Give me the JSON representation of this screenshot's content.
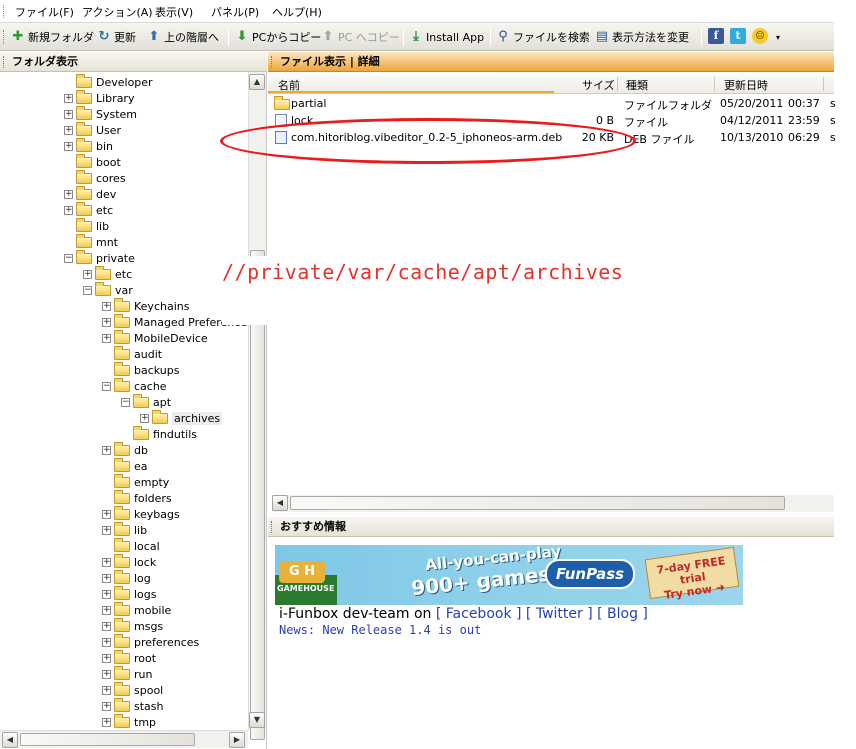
{
  "menu": [
    "ファイル(F)",
    "アクション(A)",
    "表示(V)",
    "パネル(P)",
    "ヘルプ(H)"
  ],
  "toolbar": {
    "new_folder": "新規フォルダ",
    "refresh": "更新",
    "up": "上の階層へ",
    "copy_from_pc": "PCからコピー",
    "copy_to_pc": "PC へコピー",
    "install_app": "Install App",
    "search": "ファイルを検索",
    "view_mode": "表示方法を変更"
  },
  "left_pane": {
    "title": "フォルダ表示",
    "tree": [
      {
        "label": "Developer",
        "level": 0,
        "expander": ""
      },
      {
        "label": "Library",
        "level": 0,
        "expander": "+"
      },
      {
        "label": "System",
        "level": 0,
        "expander": "+"
      },
      {
        "label": "User",
        "level": 0,
        "expander": "+"
      },
      {
        "label": "bin",
        "level": 0,
        "expander": "+"
      },
      {
        "label": "boot",
        "level": 0,
        "expander": ""
      },
      {
        "label": "cores",
        "level": 0,
        "expander": ""
      },
      {
        "label": "dev",
        "level": 0,
        "expander": "+"
      },
      {
        "label": "etc",
        "level": 0,
        "expander": "+"
      },
      {
        "label": "lib",
        "level": 0,
        "expander": ""
      },
      {
        "label": "mnt",
        "level": 0,
        "expander": ""
      },
      {
        "label": "private",
        "level": 0,
        "expander": "−"
      },
      {
        "label": "etc",
        "level": 1,
        "expander": "+"
      },
      {
        "label": "var",
        "level": 1,
        "expander": "−"
      },
      {
        "label": "Keychains",
        "level": 2,
        "expander": "+"
      },
      {
        "label": "Managed Preferences",
        "level": 2,
        "expander": "+"
      },
      {
        "label": "MobileDevice",
        "level": 2,
        "expander": "+"
      },
      {
        "label": "audit",
        "level": 2,
        "expander": ""
      },
      {
        "label": "backups",
        "level": 2,
        "expander": ""
      },
      {
        "label": "cache",
        "level": 2,
        "expander": "−"
      },
      {
        "label": "apt",
        "level": 3,
        "expander": "−"
      },
      {
        "label": "archives",
        "level": 4,
        "expander": "+",
        "selected": true
      },
      {
        "label": "findutils",
        "level": 3,
        "expander": ""
      },
      {
        "label": "db",
        "level": 2,
        "expander": "+"
      },
      {
        "label": "ea",
        "level": 2,
        "expander": ""
      },
      {
        "label": "empty",
        "level": 2,
        "expander": ""
      },
      {
        "label": "folders",
        "level": 2,
        "expander": ""
      },
      {
        "label": "keybags",
        "level": 2,
        "expander": "+"
      },
      {
        "label": "lib",
        "level": 2,
        "expander": "+"
      },
      {
        "label": "local",
        "level": 2,
        "expander": ""
      },
      {
        "label": "lock",
        "level": 2,
        "expander": "+"
      },
      {
        "label": "log",
        "level": 2,
        "expander": "+"
      },
      {
        "label": "logs",
        "level": 2,
        "expander": "+"
      },
      {
        "label": "mobile",
        "level": 2,
        "expander": "+"
      },
      {
        "label": "msgs",
        "level": 2,
        "expander": "+"
      },
      {
        "label": "preferences",
        "level": 2,
        "expander": "+"
      },
      {
        "label": "root",
        "level": 2,
        "expander": "+"
      },
      {
        "label": "run",
        "level": 2,
        "expander": "+"
      },
      {
        "label": "spool",
        "level": 2,
        "expander": "+"
      },
      {
        "label": "stash",
        "level": 2,
        "expander": "+"
      },
      {
        "label": "tmp",
        "level": 2,
        "expander": "+"
      }
    ]
  },
  "right_pane": {
    "title": "ファイル表示 | 詳細",
    "columns": {
      "name": "名前",
      "size": "サイズ",
      "type": "種類",
      "modified": "更新日時"
    },
    "files": [
      {
        "name": "partial",
        "size": "",
        "type": "ファイルフォルダ",
        "date": "05/20/2011",
        "time": "00:37",
        "icon": "folder",
        "extra": "s"
      },
      {
        "name": "lock",
        "size": "0 B",
        "type": "ファイル",
        "date": "04/12/2011",
        "time": "23:59",
        "icon": "file",
        "extra": "s"
      },
      {
        "name": "com.hitoriblog.vibeditor_0.2-5_iphoneos-arm.deb",
        "size": "20 KB",
        "type": "DEB ファイル",
        "date": "10/13/2010",
        "time": "06:29",
        "icon": "deb",
        "extra": "s"
      }
    ]
  },
  "recommend": {
    "title": "おすすめ情報",
    "banner": {
      "brand_top": "GAME",
      "brand_bottom": "HOUSE",
      "headline_top": "All-you-can-play",
      "headline_bottom": "900+ games",
      "funpass": "FunPass",
      "trial_top": "7-day FREE trial",
      "trial_bottom": "Try now"
    },
    "credit_prefix": "i-Funbox dev-team on",
    "link_facebook": "[ Facebook ]",
    "link_twitter": "[ Twitter ]",
    "link_blog": "[ Blog ]",
    "news": "News: New Release 1.4 is out"
  },
  "overlay": {
    "path": "//private/var/cache/apt/archives"
  },
  "colors": {
    "header_accent": "#f0a43a",
    "annotation_red": "#e8302a",
    "link_blue": "#2c3fb3"
  }
}
